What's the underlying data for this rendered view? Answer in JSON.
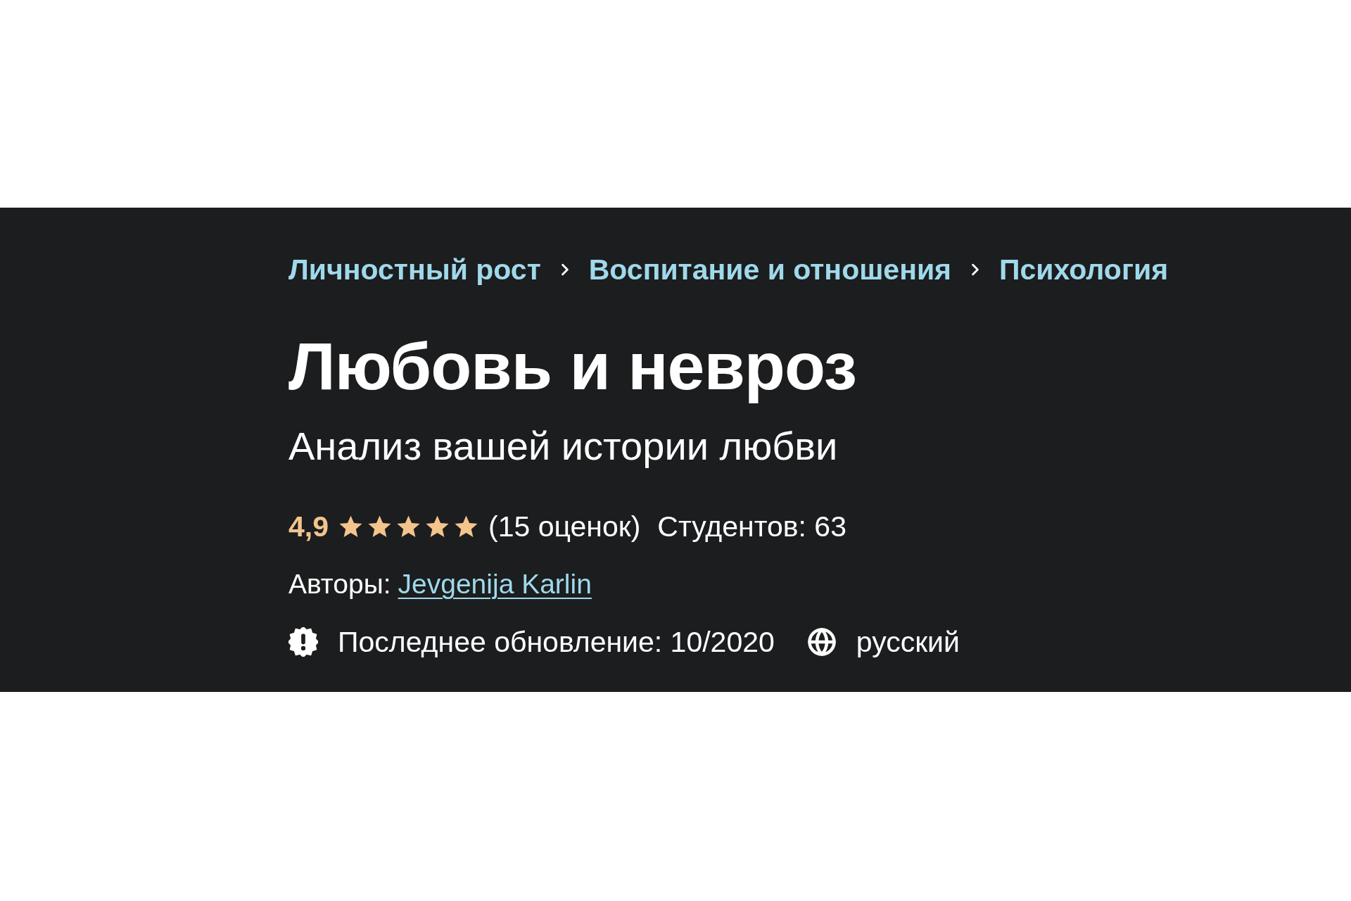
{
  "breadcrumb": [
    "Личностный рост",
    "Воспитание и отношения",
    "Психология"
  ],
  "course": {
    "title": "Любовь и невроз",
    "subtitle": "Анализ вашей истории любви"
  },
  "rating": {
    "score": "4,9",
    "stars": 5,
    "count": "(15 оценок)",
    "students": "Студентов: 63"
  },
  "authors": {
    "label": "Авторы:",
    "name": "Jevgenija Karlin"
  },
  "meta": [
    {
      "kind": "update",
      "text": "Последнее обновление: 10/2020"
    },
    {
      "kind": "language",
      "text": "русский"
    }
  ]
}
